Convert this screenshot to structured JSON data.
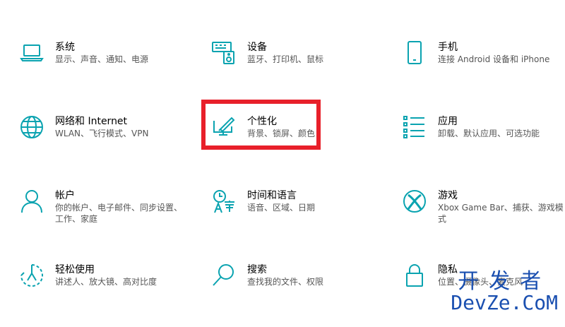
{
  "accent_color": "#0aa3b0",
  "highlight_color": "#e8202a",
  "tiles": [
    {
      "title": "系统",
      "desc": "显示、声音、通知、电源",
      "icon": "laptop-icon"
    },
    {
      "title": "设备",
      "desc": "蓝牙、打印机、鼠标",
      "icon": "keyboard-speaker-icon"
    },
    {
      "title": "手机",
      "desc": "连接 Android 设备和 iPhone",
      "icon": "phone-icon"
    },
    {
      "title": "网络和 Internet",
      "desc": "WLAN、飞行模式、VPN",
      "icon": "globe-icon"
    },
    {
      "title": "个性化",
      "desc": "背景、锁屏、颜色",
      "icon": "brush-screen-icon"
    },
    {
      "title": "应用",
      "desc": "卸载、默认应用、可选功能",
      "icon": "apps-list-icon"
    },
    {
      "title": "帐户",
      "desc": "你的帐户、电子邮件、同步设置、工作、家庭",
      "icon": "person-icon"
    },
    {
      "title": "时间和语言",
      "desc": "语音、区域、日期",
      "icon": "time-language-icon"
    },
    {
      "title": "游戏",
      "desc": "Xbox Game Bar、捕获、游戏模式",
      "icon": "xbox-icon"
    },
    {
      "title": "轻松使用",
      "desc": "讲述人、放大镜、高对比度",
      "icon": "ease-of-access-icon"
    },
    {
      "title": "搜索",
      "desc": "查找我的文件、权限",
      "icon": "search-icon"
    },
    {
      "title": "隐私",
      "desc": "位置、摄像头、麦克风",
      "icon": "lock-icon"
    }
  ],
  "watermark": {
    "top": "开发者",
    "bottom": "DevZe.CoM"
  }
}
